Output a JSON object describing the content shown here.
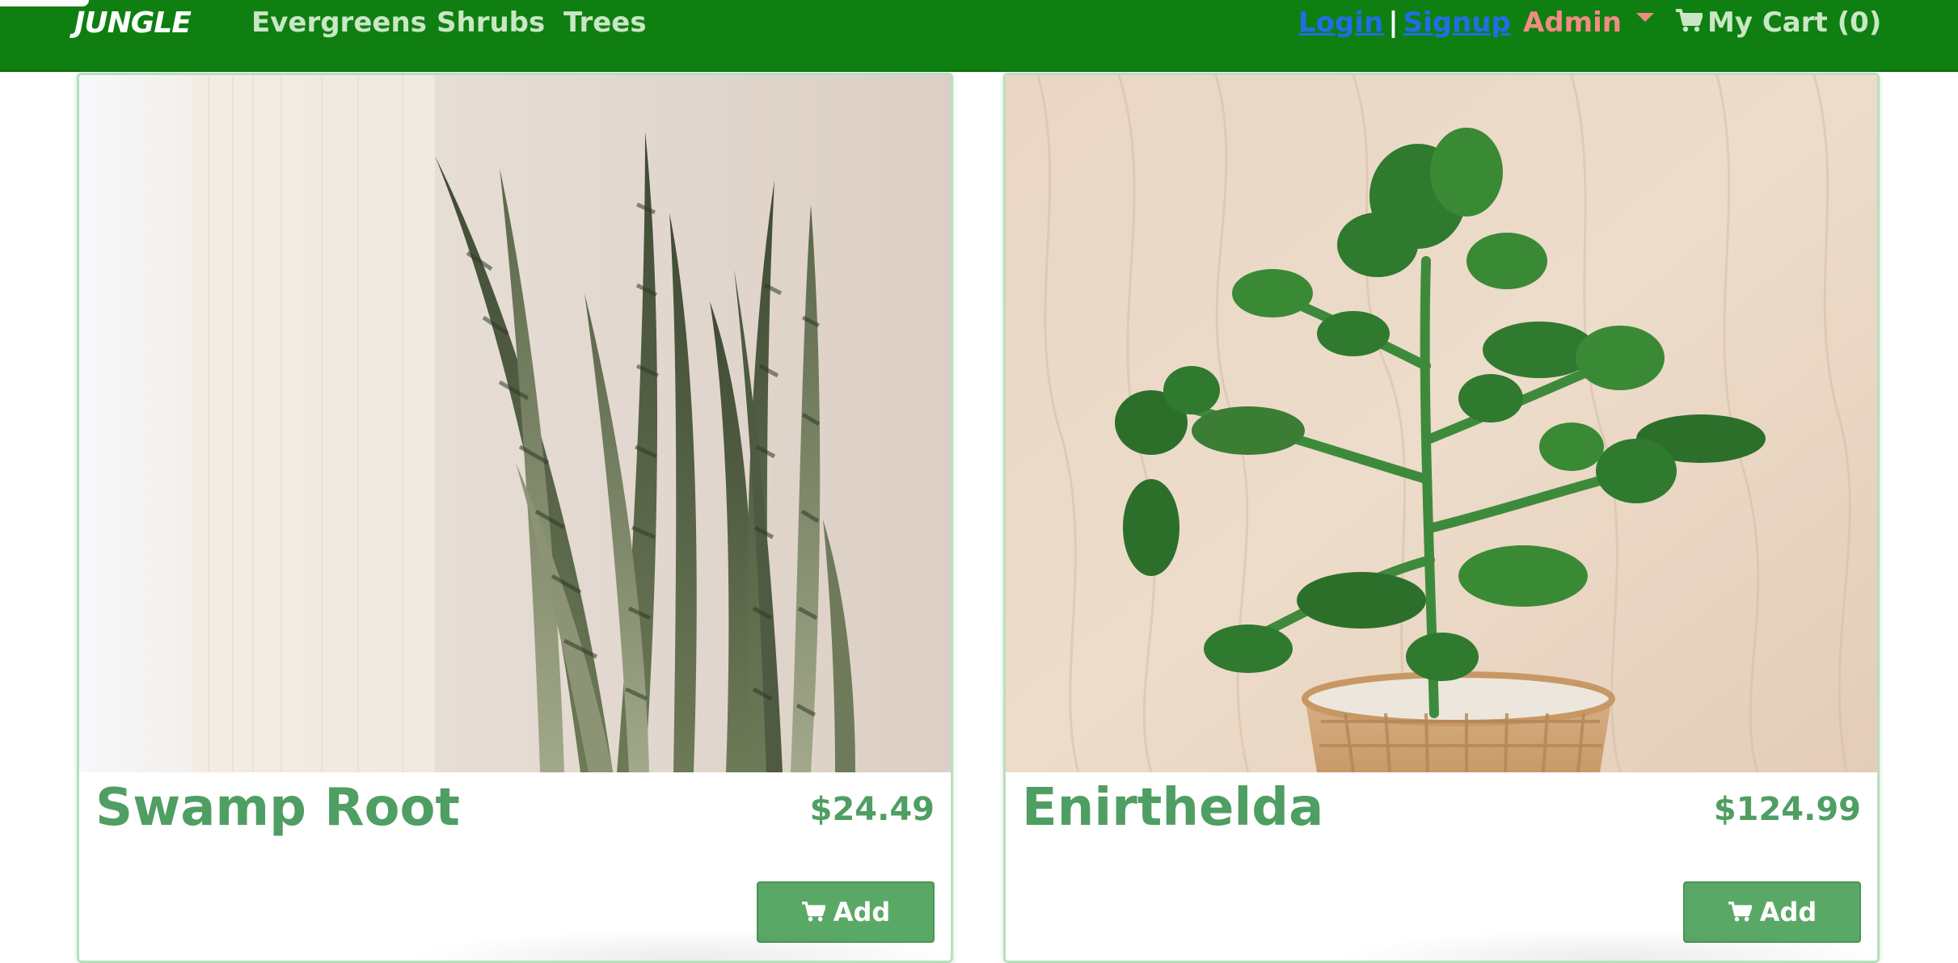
{
  "navbar": {
    "brand": "JUNGLE",
    "links": [
      "Evergreens",
      "Shrubs",
      "Trees"
    ],
    "login_label": "Login",
    "separator": "|",
    "signup_label": "Signup",
    "admin_label": "Admin",
    "cart_label": "My Cart (0)",
    "icons": {
      "cart": "shopping-cart-icon",
      "admin_dropdown": "caret-down-icon"
    },
    "colors": {
      "background": "#0f7f12",
      "link": "#c9e7c5",
      "auth_link": "#1e6fe6",
      "admin": "#f28b82"
    }
  },
  "products": [
    {
      "name": "Swamp Root",
      "price": "$24.49",
      "add_label": "Add",
      "image_icon": "snake-plant-image"
    },
    {
      "name": "Enirthelda",
      "price": "$124.99",
      "add_label": "Add",
      "image_icon": "potted-plant-image"
    }
  ],
  "colors": {
    "accent": "#4f9e63",
    "button": "#5aa866",
    "card_border": "#b9dfbe"
  }
}
